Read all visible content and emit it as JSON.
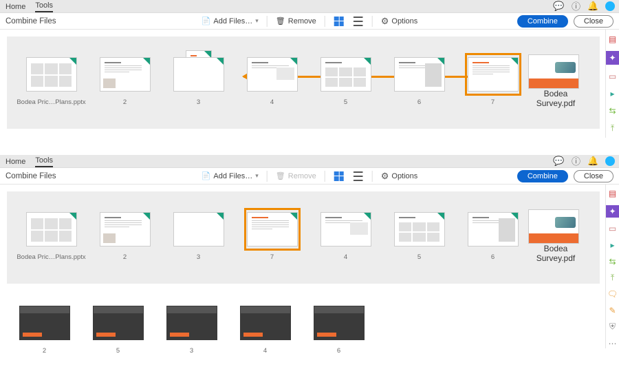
{
  "menu": {
    "home": "Home",
    "tools": "Tools"
  },
  "toolbar": {
    "title": "Combine Files",
    "add_files": "Add Files…",
    "remove": "Remove",
    "options": "Options",
    "combine": "Combine",
    "close": "Close"
  },
  "panel1": {
    "thumbs": [
      {
        "cap": "Bodea Pric…Plans.pptx",
        "type": "slides"
      },
      {
        "cap": "2",
        "type": "doc1"
      },
      {
        "cap": "3",
        "type": "doc2",
        "overlay": true
      },
      {
        "cap": "4",
        "type": "doc3"
      },
      {
        "cap": "5",
        "type": "grid"
      },
      {
        "cap": "6",
        "type": "photo"
      },
      {
        "cap": "7",
        "type": "text",
        "highlight": true
      }
    ],
    "file": {
      "cap": "Bodea Survey.pdf"
    }
  },
  "panel2": {
    "thumbs": [
      {
        "cap": "Bodea Pric…Plans.pptx",
        "type": "slides"
      },
      {
        "cap": "2",
        "type": "doc1"
      },
      {
        "cap": "3",
        "type": "doc2"
      },
      {
        "cap": "7",
        "type": "text",
        "highlight": true
      },
      {
        "cap": "4",
        "type": "doc3"
      },
      {
        "cap": "5",
        "type": "grid"
      },
      {
        "cap": "6",
        "type": "photo"
      }
    ],
    "file": {
      "cap": "Bodea Survey.pdf"
    },
    "extras": [
      {
        "cap": "2"
      },
      {
        "cap": "5"
      },
      {
        "cap": "3"
      },
      {
        "cap": "4"
      },
      {
        "cap": "6"
      }
    ]
  },
  "rail": [
    "pdf-icon",
    "combine-icon",
    "stamp-icon",
    "export-icon",
    "organize-icon"
  ]
}
